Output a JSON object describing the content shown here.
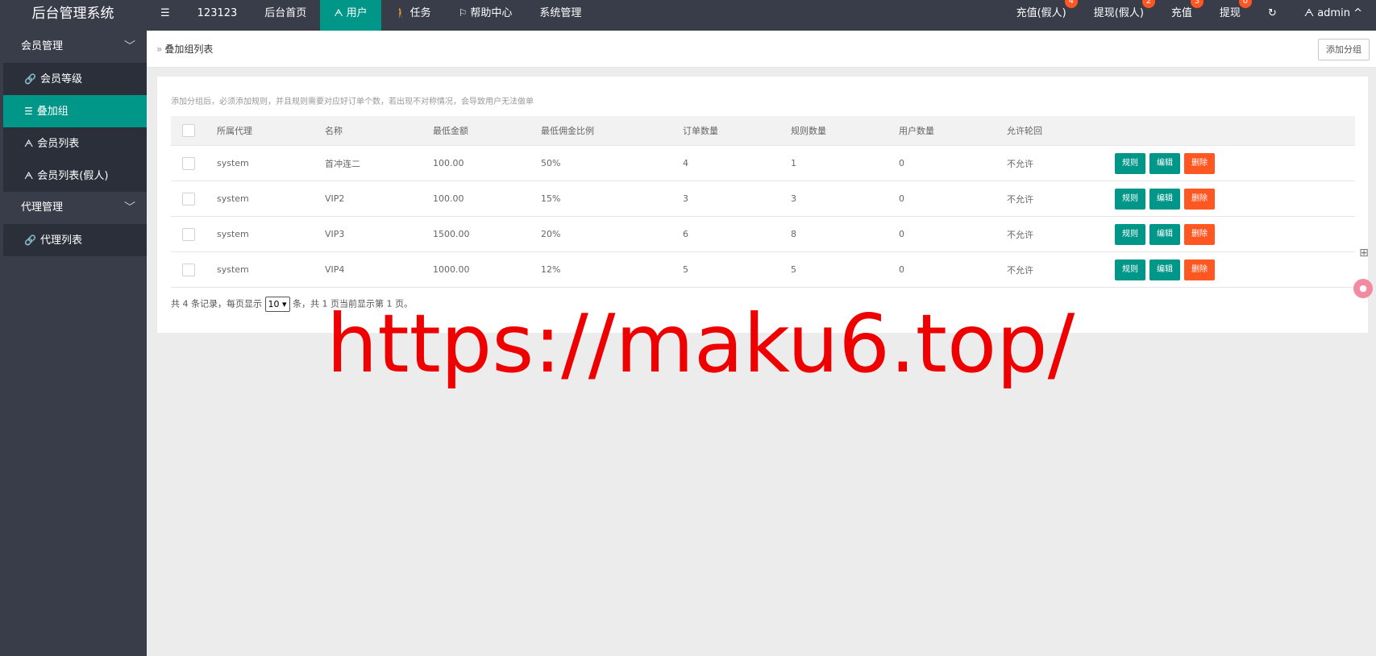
{
  "app": {
    "title": "后台管理系统"
  },
  "topnav": [
    {
      "label": "",
      "icon": "menu-icon",
      "glyph": "☰"
    },
    {
      "label": "123123"
    },
    {
      "label": "后台首页"
    },
    {
      "label": "用户",
      "icon": "user-icon",
      "glyph": "ᗅ",
      "active": true
    },
    {
      "label": "任务",
      "icon": "walk-icon",
      "glyph": "🚶"
    },
    {
      "label": "帮助中心",
      "icon": "flag-icon",
      "glyph": "⚐"
    },
    {
      "label": "系统管理"
    }
  ],
  "topright": [
    {
      "label": "充值(假人)",
      "badge": "4"
    },
    {
      "label": "提现(假人)",
      "badge": "2"
    },
    {
      "label": "充值",
      "badge": "3"
    },
    {
      "label": "提现",
      "badge": "0"
    },
    {
      "label": "",
      "icon": "refresh-icon",
      "glyph": "↻"
    },
    {
      "label": "admin",
      "icon": "user-icon",
      "glyph": "ᗅ",
      "caret": "^"
    }
  ],
  "sidebar": {
    "group1": {
      "label": "会员管理",
      "chevron": "﹀"
    },
    "items1": [
      {
        "label": "会员等级",
        "glyph": "🔗"
      },
      {
        "label": "叠加组",
        "glyph": "☰",
        "active": true
      },
      {
        "label": "会员列表",
        "glyph": "ᗅ"
      },
      {
        "label": "会员列表(假人)",
        "glyph": "ᗅ"
      }
    ],
    "group2": {
      "label": "代理管理",
      "chevron": "﹀"
    },
    "items2": [
      {
        "label": "代理列表",
        "glyph": "🔗"
      }
    ]
  },
  "breadcrumb": {
    "arrow": "»",
    "text": "叠加组列表"
  },
  "add_button": "添加分组",
  "notice": "添加分组后，必须添加规则，并且规则需要对应好订单个数，若出现不对称情况，会导致用户无法做单",
  "table": {
    "headers": [
      "所属代理",
      "名称",
      "最低金额",
      "最低佣金比例",
      "订单数量",
      "规则数量",
      "用户数量",
      "允许轮回"
    ],
    "rows": [
      [
        "system",
        "首冲连二",
        "100.00",
        "50%",
        "4",
        "1",
        "0",
        "不允许"
      ],
      [
        "system",
        "VIP2",
        "100.00",
        "15%",
        "3",
        "3",
        "0",
        "不允许"
      ],
      [
        "system",
        "VIP3",
        "1500.00",
        "20%",
        "6",
        "8",
        "0",
        "不允许"
      ],
      [
        "system",
        "VIP4",
        "1000.00",
        "12%",
        "5",
        "5",
        "0",
        "不允许"
      ]
    ],
    "actions": {
      "rule": "规则",
      "edit": "编辑",
      "delete": "删除"
    }
  },
  "pagination": {
    "prefix": "共 4 条记录，每页显示",
    "page_size": "10 ▾",
    "suffix": "条，共 1 页当前显示第 1 页。"
  },
  "watermark": "https://maku6.top/",
  "colors": {
    "topbar": "#393d49",
    "accent": "#009688",
    "danger": "#ff5722",
    "watermark": "#ee0000"
  }
}
